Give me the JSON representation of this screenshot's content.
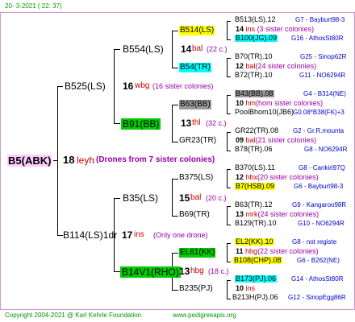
{
  "header": {
    "date": "20- 3-2021 ( 22: 37)"
  },
  "colors": {
    "yellow": "#ffff00",
    "green": "#00cc00",
    "cyan": "#00ffff",
    "link_blue": "#0000cc",
    "rel_red": "#cc0000",
    "rel_purple": "#9900aa",
    "footer_green": "#009900",
    "frame": "#cc99cc"
  },
  "root": {
    "name": "B5(ABK)",
    "gen": "18",
    "rel": "leyh",
    "note": "(Drones from 7 sister colonies)"
  },
  "dam": {
    "name": "B525(LS)",
    "gen": "16",
    "rel": "wbg",
    "note": "(16 sister colonies)"
  },
  "sire": {
    "name": "B114(LS)1dr",
    "gen": "17",
    "rel": "ins",
    "note": "(Only one drone)"
  },
  "dd": {
    "name": "B554(LS)",
    "gen": "14",
    "rel": "bal",
    "note": "(22 c.)"
  },
  "ds": {
    "name": "B91(BB)",
    "gen": "13",
    "rel": "thl",
    "note": "(32 c.)"
  },
  "sd": {
    "name": "B35(LS)",
    "gen": "15",
    "rel": "bal",
    "note": "(20 c.)"
  },
  "ss": {
    "name": "B14V1(RHO)",
    "gen": "13",
    "rel": "hbg",
    "note": "(18 c.)"
  },
  "g3": [
    {
      "name": "B514(LS)",
      "gen": "14",
      "rel": "ins",
      "note": "(3 sister colonies)"
    },
    {
      "name": "B54(TR)",
      "gen": "12",
      "rel": "bal",
      "note": "(24 sister colonies)"
    },
    {
      "name": "B63(BB)",
      "gen": "10",
      "rel": "hm",
      "note": "(hom sister colonies)"
    },
    {
      "name": "GR23(TR)",
      "gen": "09",
      "rel": "bal",
      "note": "(21 sister colonies)"
    },
    {
      "name": "B375(LS)",
      "gen": "12",
      "rel": "hbx",
      "note": "(20 sister colonies)"
    },
    {
      "name": "B69(TR)",
      "gen": "13",
      "rel": "mrk",
      "note": "(24 sister colonies)"
    },
    {
      "name": "EL61(KK)",
      "gen": "11",
      "rel": "hbg",
      "note": "(22 sister colonies)"
    },
    {
      "name": "B235(PJ)",
      "gen": "10",
      "rel": "ins",
      "note": ""
    }
  ],
  "g4": [
    {
      "name": "B513(LS).12",
      "link": "G7 - Bayburt98-3"
    },
    {
      "name": "B100(JG).09",
      "link": "G16 - AthosSt80R"
    },
    {
      "name": "B70(TR).10",
      "link": "G25 - Sinop62R"
    },
    {
      "name": "B72(TR).10",
      "link": "G11 - NO6294R"
    },
    {
      "name": "B43(BB).08",
      "link": "G4 - B314(NE)"
    },
    {
      "name": "PoolBhom10(JB6)",
      "link": "G0.08*B38(FK)+3"
    },
    {
      "name": "GR22(TR).08",
      "link": "G2 - Gr.R.mounta"
    },
    {
      "name": "B78(TR).06",
      "link": "G8 - NO6294R"
    },
    {
      "name": "B370(LS).11",
      "link": "G8 - Cankiri97Q"
    },
    {
      "name": "B7(HSB).09",
      "link": "G6 - Bayburt98-3"
    },
    {
      "name": "B63(TR).12",
      "link": "G9 - Kangaroo98R"
    },
    {
      "name": "B129(TR).10",
      "link": "G10 - NO6294R"
    },
    {
      "name": "EL2(KK).10",
      "link": "G8 - not registe"
    },
    {
      "name": "B108(CHP).08",
      "link": "G6 - B262(NE)"
    },
    {
      "name": "B173(PJ).06",
      "link": "G14 - AthosSt80R"
    },
    {
      "name": "B213H(PJ).06",
      "link": "G12 - SinopEgg86R"
    }
  ],
  "footer": {
    "copyright": "Copyright 2004-2021 @ Karl Kehrle Foundation",
    "url": "www.pedigreeapis.org"
  }
}
